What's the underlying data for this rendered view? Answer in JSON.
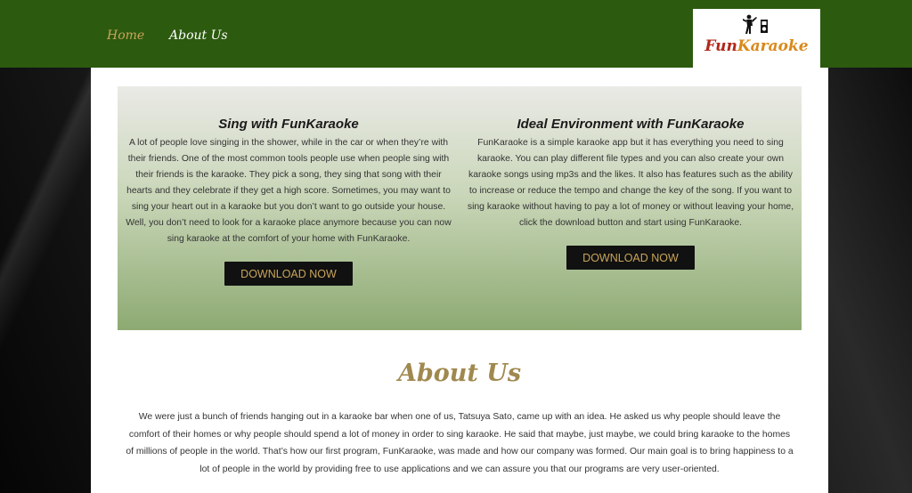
{
  "nav": {
    "items": [
      {
        "label": "Home"
      },
      {
        "label": "About Us"
      }
    ]
  },
  "logo": {
    "text_a": "Fun",
    "text_b": "Karaoke",
    "icon": "singer-with-speaker-icon"
  },
  "hero": {
    "left": {
      "title": "Sing with FunKaraoke",
      "body": "A lot of people love singing in the shower, while in the car or when they’re with their friends. One of the most common tools people use when people sing with their friends is the karaoke. They pick a song, they sing that song with their hearts and they celebrate if they get a high score. Sometimes, you may want to sing your heart out in a karaoke but you don’t want to go outside your house. Well, you don’t need to look for a karaoke place anymore because you can now sing karaoke at the comfort of your home with FunKaraoke.",
      "button": "DOWNLOAD NOW"
    },
    "right": {
      "title": "Ideal Environment with FunKaraoke",
      "body": "FunKaraoke is a simple karaoke app but it has everything you need to sing karaoke. You can play different file types and you can also create your own karaoke songs using mp3s and the likes. It also has features such as the ability to increase or reduce the tempo and change the key of the song. If you want to sing karaoke without having to pay a lot of money or without leaving your home, click the download button and start using FunKaraoke.",
      "button": "DOWNLOAD NOW"
    }
  },
  "about": {
    "title": "About Us",
    "body": "We were just a bunch of friends hanging out in a karaoke bar when one of us, Tatsuya Sato, came up with an idea. He asked us why people should leave the comfort of their homes or why people should spend a lot of money in order to sing karaoke. He said that maybe, just maybe, we could bring karaoke to the homes of millions of people in the world. That’s how our first program, FunKaraoke, was made and how our company was formed. Our main goal is to bring happiness to a lot of people in the world by providing free to use applications and we can assure you that our programs are very user-oriented."
  },
  "colors": {
    "nav_bg": "#2c5a0f",
    "accent_gold": "#c9a55a",
    "about_title": "#a0894f",
    "logo_red": "#b0281a",
    "logo_orange": "#d9891a"
  }
}
